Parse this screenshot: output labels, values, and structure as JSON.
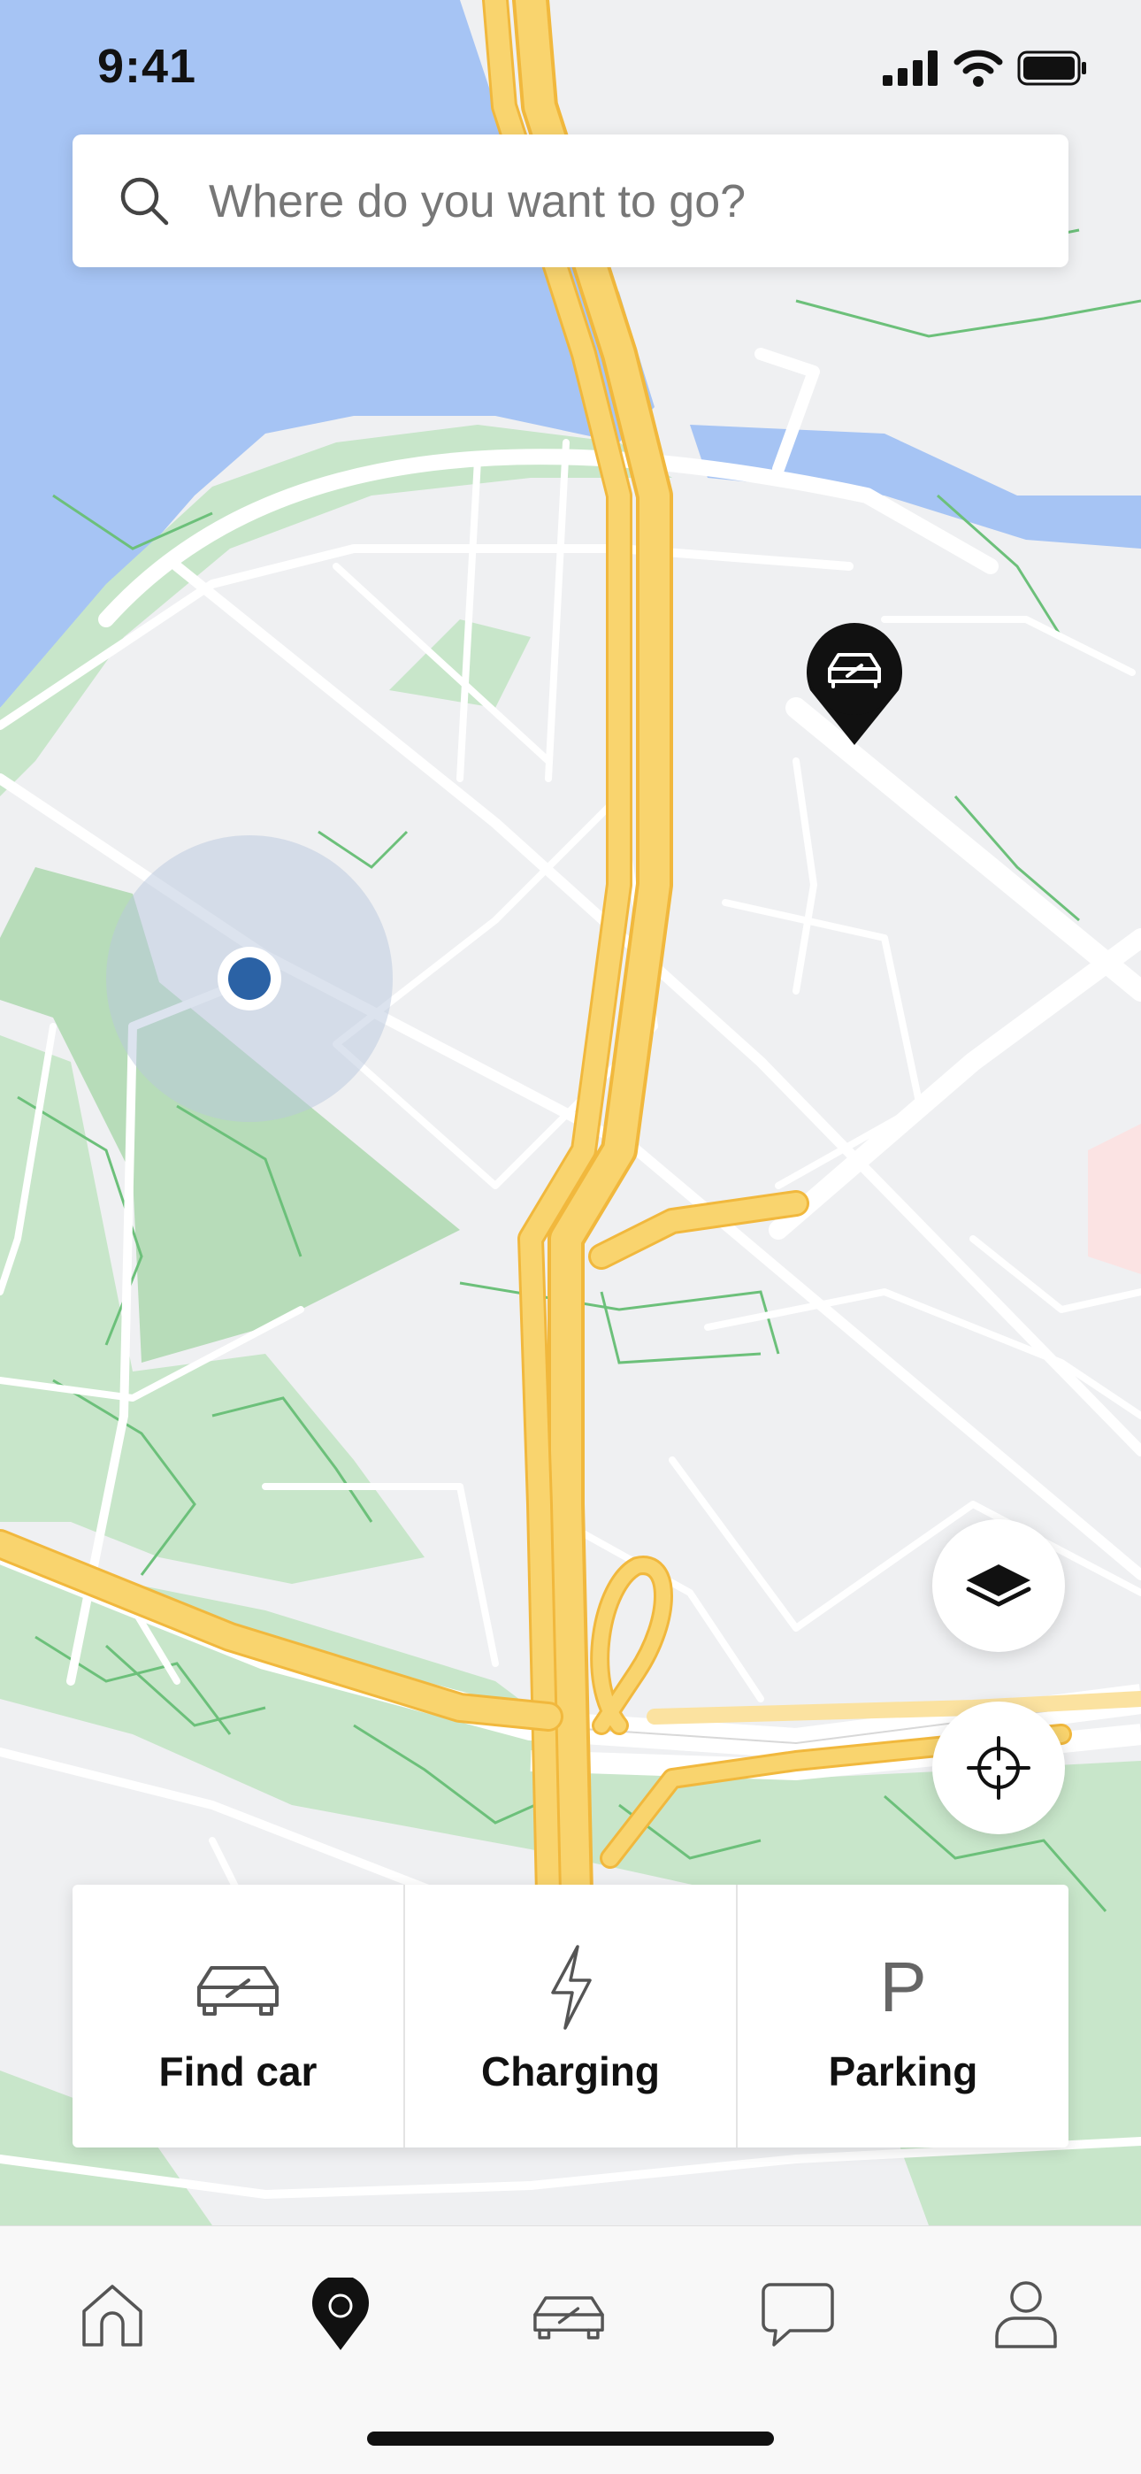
{
  "status_bar": {
    "time": "9:41",
    "icons": [
      "signal-icon",
      "wifi-icon",
      "battery-icon"
    ]
  },
  "search": {
    "placeholder": "Where do you want to go?",
    "value": ""
  },
  "map": {
    "markers": [
      "user-location-marker",
      "car-location-pin"
    ],
    "controls": [
      "layers-icon",
      "locate-icon"
    ],
    "colors": {
      "water": "#a6c4f4",
      "park": "#c8e6ca",
      "park_line": "#6cc07a",
      "highway": "#f9d46e",
      "highway_edge": "#f1b83d",
      "land": "#eff0f2",
      "road": "#ffffff",
      "user_dot": "#2b62a5"
    }
  },
  "actions": [
    {
      "label": "Find car",
      "icon": "car-icon"
    },
    {
      "label": "Charging",
      "icon": "lightning-icon"
    },
    {
      "label": "Parking",
      "icon": "parking-icon",
      "glyph": "P"
    }
  ],
  "tabbar": {
    "tabs": [
      {
        "name": "home",
        "icon": "home-icon"
      },
      {
        "name": "map",
        "icon": "map-pin-icon",
        "active": true
      },
      {
        "name": "car",
        "icon": "car-icon"
      },
      {
        "name": "messages",
        "icon": "chat-icon"
      },
      {
        "name": "profile",
        "icon": "person-icon"
      }
    ]
  }
}
